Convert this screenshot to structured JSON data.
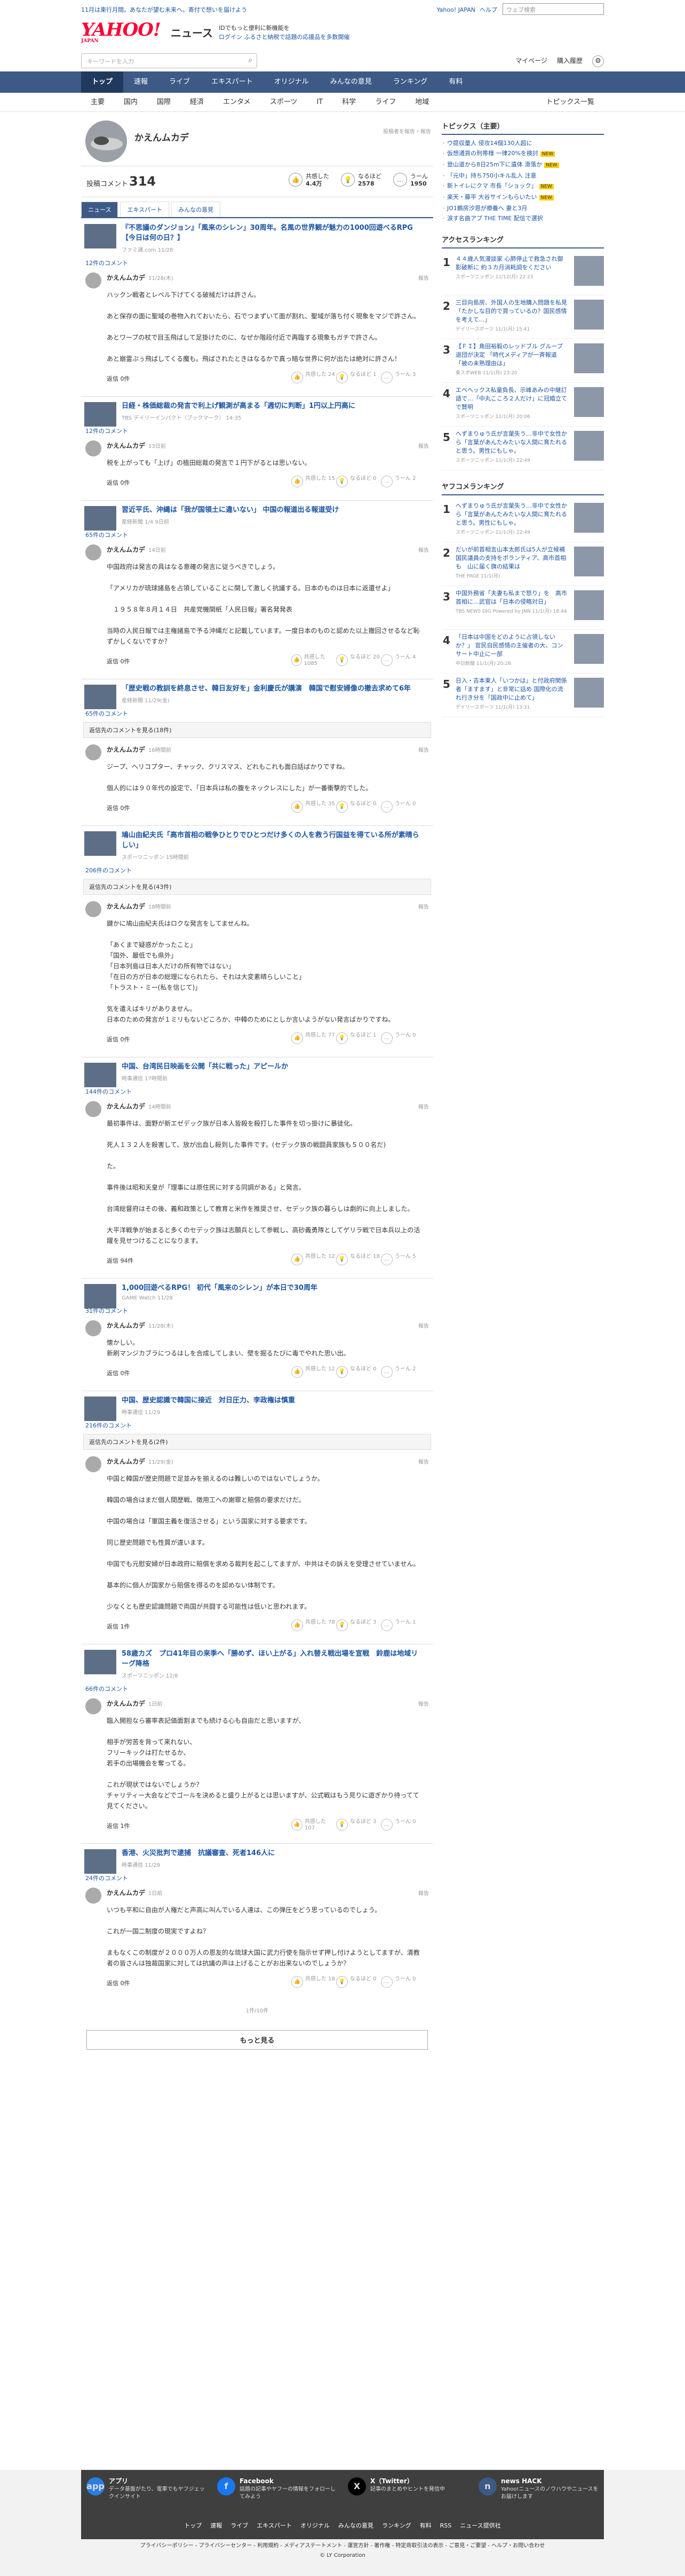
{
  "header": {
    "promo": "11月は東行月間。あなたが望む未来へ。寄付で想いを届けよう",
    "logo": "YAHOO!",
    "logo_sub": "JAPAN",
    "news_label": "ニュース",
    "msg1": "IDでもっと便利に新機能を",
    "msg2": "ログイン ふるさと納税で話題の応援品を多数開催",
    "toplinks": [
      "Yahoo! JAPAN",
      "ヘルプ"
    ],
    "site_search": "ウェブ検索",
    "search_placeholder": "キーワードを入力",
    "mypage": "マイページ",
    "setting": "購入履歴"
  },
  "gnav": [
    "トップ",
    "速報",
    "ライブ",
    "エキスパート",
    "オリジナル",
    "みんなの意見",
    "ランキング",
    "有料"
  ],
  "snav": [
    "主要",
    "国内",
    "国際",
    "経済",
    "エンタメ",
    "スポーツ",
    "IT",
    "科学",
    "ライフ",
    "地域"
  ],
  "snav_last": "トピックス一覧",
  "profile": {
    "name": "かえんムカデ",
    "report": "投稿者を報告・報告",
    "post_label": "投稿コメント",
    "post_count": "314",
    "stats": [
      {
        "icon": "thumb",
        "label": "共感した",
        "value": "4.4万"
      },
      {
        "icon": "bulb",
        "label": "なるほど",
        "value": "2578"
      },
      {
        "icon": "hmm",
        "label": "うーん",
        "value": "1950"
      }
    ],
    "tabs": [
      "ニュース",
      "エキスパート",
      "みんなの意見"
    ]
  },
  "articles": [
    {
      "title": "『不思議のダンジョン』「風来のシレン」30周年。名風の世界観が魅力の1000回遊べるRPG【今日は何の日？】",
      "source": "ファミ通.com 11/28",
      "count": "12件のコメント",
      "show_more": "",
      "comment": {
        "name": "かえんムカデ",
        "time": "11/28(木)",
        "report": "報告",
        "body": "ハックン戦者とレベル下げてくる破械だけは許さん。\n\nあと保存の面に聖域の巻物入れておいたら、石でつまずいて面が割れ、聖域が落ち付く現象をマジで許さん。\n\nあとワープの杖で目玉飛ばして足掛けたのに、なぜか階段付近で再臨する現象もガチで許さん。\n\nあと崩霊ぷぅ飛ばしてくる魔も。飛ばされたときはなるかで真っ暗な世界に何が出たは絶対に許さん！",
        "reply": "返信 0件",
        "votes": [
          "共感した 24",
          "なるほど 1",
          "うーん 3"
        ]
      }
    },
    {
      "title": "日経・株価総裁の発言で利上げ観測が高まる「週切に判断」1円以上円高に",
      "source": "TBS デイリーインパクト（ブックマーク） 14:35",
      "count": "12件のコメント",
      "show_more": "",
      "comment": {
        "name": "かえんムカデ",
        "time": "13日前",
        "report": "報告",
        "body": "税を上がっても「上げ」の植田総裁の発言で１円下がるとは思いない。",
        "reply": "返信 0件",
        "votes": [
          "共感した 15",
          "なるほど 0",
          "うーん 2"
        ]
      }
    },
    {
      "title": "習近平氏、沖縄は「我が国領土に違いない」 中国の報道出る報道受け",
      "source": "産経新聞 1/4 9日前",
      "count": "65件のコメント",
      "show_more": "",
      "comment": {
        "name": "かえんムカデ",
        "time": "14日前",
        "report": "報告",
        "body": "中国政府は発言の具はなる意確の発言に従うべきでしょう。\n\n「アメリカが琉球諸島を占領していることに関して激しく抗議する。日本のものは日本に返還せよ」\n\n　１９５８年８月１４日　共産党機関紙「人民日報」署名発発表\n\n当時の人民日報では主権諸島で予る沖縄だと記載しています。一度日本のものと認めた以上撤回させるなど恥ずかしくないですか？",
        "reply": "返信 0件",
        "votes": [
          "共感した 1085",
          "なるほど 20",
          "うーん 4"
        ]
      }
    },
    {
      "title": "「歴史戦の教訓を終息させ、韓日友好を」金利慶氏が講演　韓国で慰安婦像の撤去求めて6年",
      "source": "産経新聞 11/29(金)",
      "count": "65件のコメント",
      "show_more": "返信先のコメントを見る(18件)",
      "comment": {
        "name": "かえんムカデ",
        "time": "16時間前",
        "report": "報告",
        "body": "ジープ、ヘリコプター、チャック、クリスマス、どれもこれも面白話ばかりですね。\n\n個人的には９０年代の設定で、「日本兵は私の腹をネックレスにした」が一番衝撃的でした。",
        "reply": "返信 0件",
        "votes": [
          "共感した 35",
          "なるほど 0",
          "うーん 0"
        ]
      }
    },
    {
      "title": "鳩山由紀夫氏「高市首相の戦争ひとりでひとつだけ多くの人を救う行国益を得ている所が素晴らしい」",
      "source": "スポーツニッポン 15時間前",
      "count": "206件のコメント",
      "show_more": "返信先のコメントを見る(43件)",
      "comment": {
        "name": "かえんムカデ",
        "time": "18時間前",
        "report": "報告",
        "body": "鍵かに鳩山由紀夫氏はロクな発言をしてませんね。\n\n「あくまで疑惑がかったこと」\n「国外、最低でも県外」\n「日本列島は日本人だけの所有物ではない」\n「在日の方が日本の総理になられたら、それは大変素晴らしいこと」\n「トラスト・ミー(私を信じて)」\n\n気を遣えばキリがありません。\n日本のための発言が１ミリもないどころか、中韓のためにとしか言いようがない発言ばかりですね。",
        "reply": "返信 0件",
        "votes": [
          "共感した 77",
          "なるほど 1",
          "うーん 0"
        ]
      }
    },
    {
      "title": "中国、台湾民日映画を公開「共に戦った」アピールか",
      "source": "時事通信 17時間前",
      "count": "144件のコメント",
      "show_more": "",
      "comment": {
        "name": "かえんムカデ",
        "time": "14時間前",
        "report": "報告",
        "body": "最初事件は、面野が新エゼデック族が日本人皆殺を殺打した事件を切っ掛けに暴徒化。\n\n死人１３２人を殺害して、放が出血し殺到した事件です。(セデック族の戦闘員家族も５００名だ)\n\nた。\n\n事件後は昭和天皇が「理事には原住民に対する同調がある」と発言。\n\n台湾総督府はその後、義和政策として教育と米作を推奨させ、セデック族の暮らしは劇的に向上しました。\n\n大平洋戦争が始まると多くのセデック族は志願兵として参戦し、高砂義勇隊としてゲリラ戦で日本兵以上の活躍を見せつけることになります。",
        "reply": "返信 94件",
        "votes": [
          "共感した 12",
          "なるほど 18",
          "うーん 5"
        ]
      }
    },
    {
      "title": "1,000回遊べるRPG！ 初代「風来のシレン」が本日で30周年",
      "source": "GAME Watch 11/28",
      "count": "31件のコメント",
      "show_more": "",
      "comment": {
        "name": "かえんムカデ",
        "time": "11/28(木)",
        "report": "報告",
        "body": "懐かしい。\n新刷マンジカブラにつるはしを合成してしまい、壁を掘るたびに毒でやれた思い出。",
        "reply": "返信 0件",
        "votes": [
          "共感した 12",
          "なるほど 0",
          "うーん 2"
        ]
      }
    },
    {
      "title": "中国、歴史認識で韓国に接近　対日圧力、李政権は慎重",
      "source": "時事通信 11/29",
      "count": "216件のコメント",
      "show_more": "返信先のコメントを見る(2件)",
      "comment": {
        "name": "かえんムカデ",
        "time": "11/29(金)",
        "report": "報告",
        "body": "中国と韓国が歴史問題で足並みを揃えるのは難しいのではないでしょうか。\n\n韓国の場合はまだ個人間歴戦、徴用工への謝罪と賠償の要求だけだ。\n\n中国の場合は「軍国主義を復活させる」という国家に対する要求です。\n\n同じ歴史問題でも性質が違います。\n\n中国でも元慰安婦が日本政府に賠償を求める裁判を起こしてますが、中共はその訴えを受理させていません。\n\n基本的に個人が国家から賠償を得るのを認めない体制です。\n\n少なくとも歴史認識問題で両国が共闘する可能性は低いと思われます。",
        "reply": "返信 1件",
        "votes": [
          "共感した 78",
          "なるほど 3",
          "うーん 1"
        ]
      }
    },
    {
      "title": "58歳カズ　プロ41年目の来季へ「勝めず、ほい上がる」入れ替え戦出場を宣戦　鈴鹿は地域リーグ降格",
      "source": "スポーツニッポン 12/8",
      "count": "66件のコメント",
      "show_more": "",
      "comment": {
        "name": "かえんムカデ",
        "time": "1日前",
        "report": "報告",
        "body": "臨入開担なら審率表記価面割までも続ける心も自由だと思いますが、\n\n相手が労苦を背って来れない、\nフリーキックは打たせるか、\n若手の出場機会を奪ってる。\n\nこれが現状ではないでしょうか？\nチャリティー大会などでゴールを決めると盛り上がるとは思いますが、公式戦はもう見りに遊ぎかり待ってて見てください。",
        "reply": "返信 1件",
        "votes": [
          "共感した 107",
          "なるほど 3",
          "うーん 0"
        ]
      }
    },
    {
      "title": "香港、火災批判で逮捕　抗議審査、死者146人に",
      "source": "時事通信 11/29",
      "count": "24件のコメント",
      "show_more": "",
      "comment": {
        "name": "かえんムカデ",
        "time": "1日前",
        "report": "報告",
        "body": "いつも平和に自由が人権だと声高に叫んでいる人達は、この弾圧をどう思っているのでしょう。\n\nこれが一国二制度の現実ですよね？\n\nまもなくこの制度が２０００万人の恩友的な琉球大国に武力行使を指示せず押し付けようとしてますが、清教者の皆さんは独裁国家に対しては抗議の声は上げることがお出来ないのでしょうか？",
        "reply": "返信 0件",
        "votes": [
          "共感した 18",
          "なるほど 0",
          "うーん 0"
        ]
      }
    }
  ],
  "pagination": "1件/10件",
  "more_button": "もっと見る",
  "side": {
    "topics_title": "トピックス（主要）",
    "topics": [
      {
        "text": "ウ提収量人 侵攻14個130人超に",
        "new": ""
      },
      {
        "text": "仮想通貨の刑帯様 一律20%を検討",
        "new": "NEW"
      },
      {
        "text": "登山道から8日25m下に遺体 滑落か",
        "new": "NEW"
      },
      {
        "text": "「元中」持ち750小キル乱入 注意",
        "new": ""
      },
      {
        "text": "新トイレにクマ 市長「ショック」",
        "new": "NEW"
      },
      {
        "text": "楽天・藤平 大谷サインもらいたい",
        "new": "NEW"
      },
      {
        "text": "JO1鶴房汐恩が療養へ 妻と3月",
        "new": ""
      },
      {
        "text": "涙す名曲アプ THE TIME 配信で選択",
        "new": ""
      }
    ],
    "access_title": "アクセスランキング",
    "access": [
      {
        "no": "1",
        "text": "４４歳人気漫談家 心肺停止で救急され御影破断に 約３カ月消耗調をください",
        "meta": "スポーツニッポン 11/12(月) 22:23"
      },
      {
        "text": "三目向島房、外国人の生地購入問題を私見「たかしな目的で買っているの？国民感情を考えて…」",
        "meta": "デイリースポーツ 11/1(月) 15:41",
        "no": "2"
      },
      {
        "no": "3",
        "text": "【ＦＩ】角田裕毅のレッドブル グループ退団が決定 「時代メディアが一斉報道「被の未熟理由は」",
        "meta": "東スポWEB 11/1(月) 23:20"
      },
      {
        "no": "4",
        "text": "エベヘックス私童負長、示峰あみの中継訂語で…「中丸こころ２人だけ」に冠婚立てで賢明",
        "meta": "スポーツニッポン 11/1(月) 20:06"
      },
      {
        "no": "5",
        "text": "へずまりゅう氏が言葉失う…非中で女性から「言葉があんたみたいな人間に育たれると思う。男性にもしゃ。",
        "meta": "スポーツニッポン 11/1(月) 22:49"
      }
    ],
    "yahoo_title": "ヤフコメランキング",
    "yahoo": [
      {
        "no": "1",
        "text": "へずまりゅう氏が言葉失う…非中で女性から「言葉があんたみたいな人間に育たれると思う。男性にもしゃ。",
        "meta": "スポーツニッポン 11/1(月) 22:49"
      },
      {
        "no": "2",
        "text": "だいが前首相言山本太郎氏は5人が立候補　国民議員の支持をポランティア、高市首相も　山に届く旗の結果は",
        "meta": "THE PAGE 11/1(月)"
      },
      {
        "no": "3",
        "text": "中国外務省「夫妻も私まで怒り」を　高市首相に…武官は「日本の侵略対日」",
        "meta": "TBS NEWS DIG Powered by JNN 11/1(月) 18:44"
      },
      {
        "no": "4",
        "text": "「日本は中国をどのように占領しないか？」 官民自民感情の主催者の大、コンサート中止に一部",
        "meta": "中日新聞 11/1(月) 20:28"
      },
      {
        "no": "5",
        "text": "日入・吉本東人「いつかは」と付政府関係者「ますます」と非常に話め 国際化の流れ行き分を「国政中に止めて」",
        "meta": "デイリースポーツ 11/1(月) 13:31"
      }
    ]
  },
  "footer": {
    "apps": [
      {
        "title": "アプリ",
        "desc": "データ基盤がたり、電車でもヤフジェックインサイト",
        "icon": "app"
      },
      {
        "title": "Facebook",
        "desc": "話題の記事やヤフーの情報をフォローしてみよう",
        "icon": "f"
      },
      {
        "title": "X（Twitter）",
        "desc": "記事のまとめやヒントを発信中",
        "icon": "X"
      },
      {
        "title": "news HACK",
        "desc": "Yahoo!ニュースのノウハウやニュースをお届けします",
        "icon": "n"
      }
    ],
    "links": [
      "トップ",
      "速報",
      "ライブ",
      "エキスパート",
      "オリジナル",
      "みんなの意見",
      "ランキング",
      "有料",
      "RSS",
      "ニュース提供社"
    ],
    "bottom1": "プライバシーポリシー - プライバシーセンター - 利用規約 - メディアステートメント - 運営方針 - 著作権 - 特定商取引法の表示 - ご意見・ご要望 - ヘルプ・お問い合わせ",
    "bottom2": "© LY Corporation"
  }
}
